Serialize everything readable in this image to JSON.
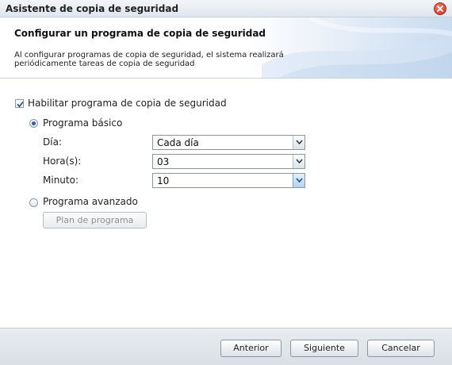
{
  "window": {
    "title": "Asistente de copia de seguridad",
    "accent_color": "#2b63a7",
    "close_color": "#c8321f"
  },
  "header": {
    "title": "Configurar un programa de copia de seguridad",
    "description": "Al configurar programas de copia de seguridad, el sistema realizará periódicamente tareas de copia de seguridad"
  },
  "schedule": {
    "enable_label": "Habilitar programa de copia de seguridad",
    "enable_checked": true,
    "basic_label": "Programa básico",
    "basic_selected": true,
    "day_label": "Día:",
    "day_value": "Cada día",
    "hour_label": "Hora(s):",
    "hour_value": "03",
    "minute_label": "Minuto:",
    "minute_value": "10",
    "advanced_label": "Programa avanzado",
    "advanced_selected": false,
    "plan_button": "Plan de programa"
  },
  "footer": {
    "back_label": "Anterior",
    "next_label": "Siguiente",
    "cancel_label": "Cancelar"
  }
}
